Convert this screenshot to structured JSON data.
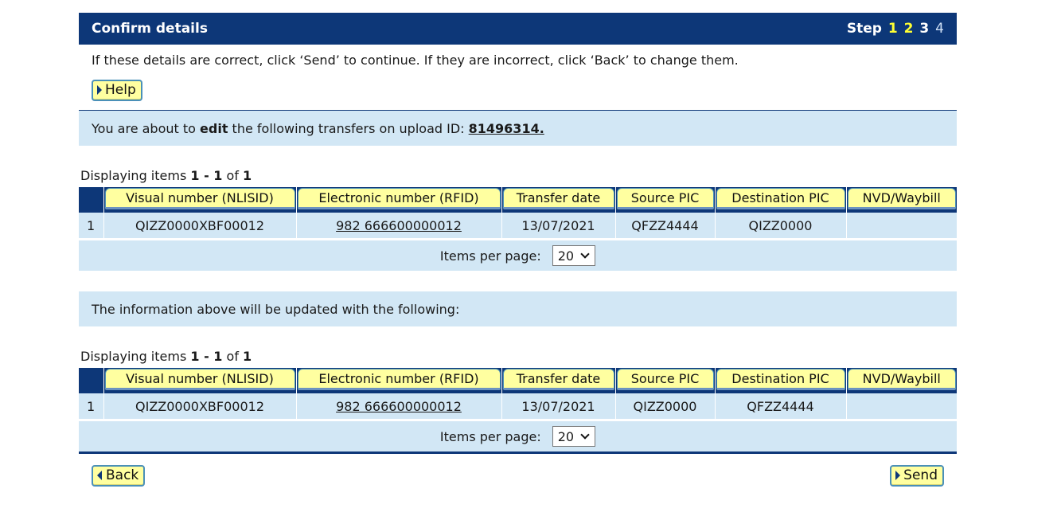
{
  "header": {
    "title": "Confirm details",
    "step_label": "Step",
    "steps": [
      {
        "label": "1",
        "state": "done"
      },
      {
        "label": "2",
        "state": "done"
      },
      {
        "label": "3",
        "state": "current"
      },
      {
        "label": "4",
        "state": "todo"
      }
    ]
  },
  "intro_text": "If these details are correct, click ‘Send’ to continue. If they are incorrect, click ‘Back’ to change them.",
  "help_label": "Help",
  "edit_notice": {
    "prefix": "You are about to ",
    "action": "edit",
    "middle": " the following transfers on upload ID: ",
    "upload_id": "81496314."
  },
  "columns": [
    "Visual number (NLISID)",
    "Electronic number (RFID)",
    "Transfer date",
    "Source PIC",
    "Destination PIC",
    "NVD/Waybill"
  ],
  "current": {
    "displaying": {
      "prefix": "Displaying items ",
      "from": "1",
      "sep": " - ",
      "to": "1",
      "of": " of ",
      "total": "1"
    },
    "rows": [
      {
        "num": "1",
        "visual": "QIZZ0000XBF00012",
        "rfid": "982 666600000012",
        "date": "13/07/2021",
        "source": "QFZZ4444",
        "destination": "QIZZ0000",
        "nvd": ""
      }
    ],
    "items_per_page_label": "Items per page:",
    "items_per_page": "20"
  },
  "update_notice": "The information above will be updated with the following:",
  "updated": {
    "displaying": {
      "prefix": "Displaying items ",
      "from": "1",
      "sep": " - ",
      "to": "1",
      "of": " of ",
      "total": "1"
    },
    "rows": [
      {
        "num": "1",
        "visual": "QIZZ0000XBF00012",
        "rfid": "982 666600000012",
        "date": "13/07/2021",
        "source": "QIZZ0000",
        "destination": "QFZZ4444",
        "nvd": ""
      }
    ],
    "items_per_page_label": "Items per page:",
    "items_per_page": "20"
  },
  "footer": {
    "back_label": "Back",
    "send_label": "Send"
  },
  "colors": {
    "brand_navy": "#0d3778",
    "info_bg": "#d2e7f5",
    "button_bg": "#ffffa0",
    "step_done": "#ffff33"
  }
}
